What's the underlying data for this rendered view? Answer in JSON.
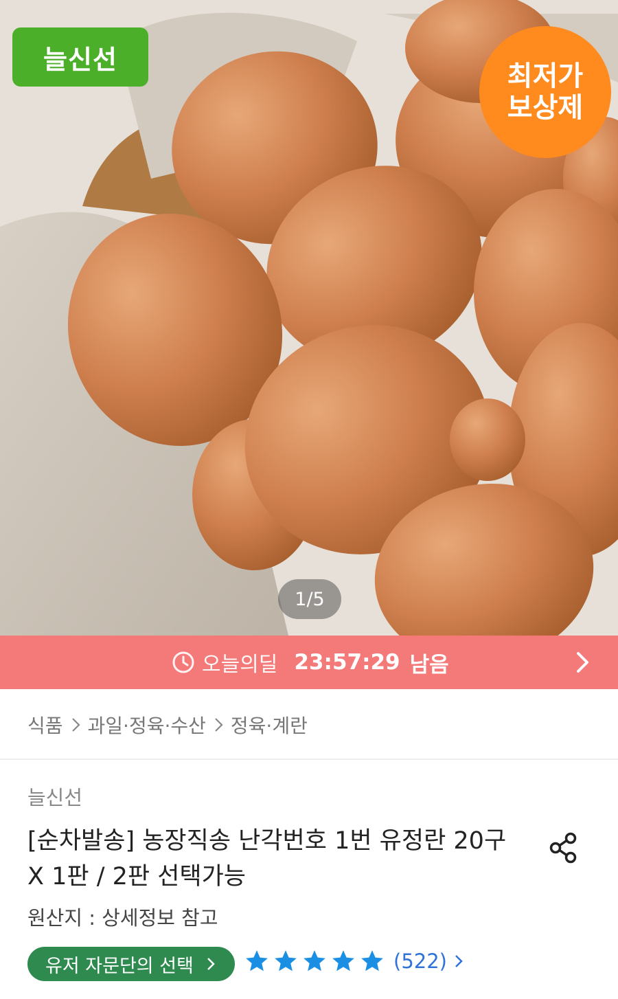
{
  "hero": {
    "brand_badge": "늘신선",
    "price_badge_line1": "최저가",
    "price_badge_line2": "보상제",
    "page_indicator": "1/5"
  },
  "deal": {
    "label": "오늘의딜",
    "timer": "23:57:29",
    "remain": "남음"
  },
  "breadcrumb": {
    "items": [
      "식품",
      "과일·정육·수산",
      "정육·계란"
    ]
  },
  "product": {
    "seller": "늘신선",
    "title": "[순차발송] 농장직송 난각번호 1번 유정란 20구 X 1판 / 2판 선택가능",
    "origin": "원산지 : 상세정보 참고",
    "advisor_label": "유저 자문단의 선택",
    "rating": 5,
    "review_count": "(522)"
  },
  "colors": {
    "deal_bar": "#f47a7a",
    "brand_green": "#4caf2a",
    "price_orange": "#ff8a1e",
    "advisor_green": "#2e8a4e",
    "star_blue": "#1a8fe3",
    "review_blue": "#2f73d9"
  },
  "icons": [
    "clock-icon",
    "chevron-right-icon",
    "share-icon",
    "star-icon"
  ]
}
